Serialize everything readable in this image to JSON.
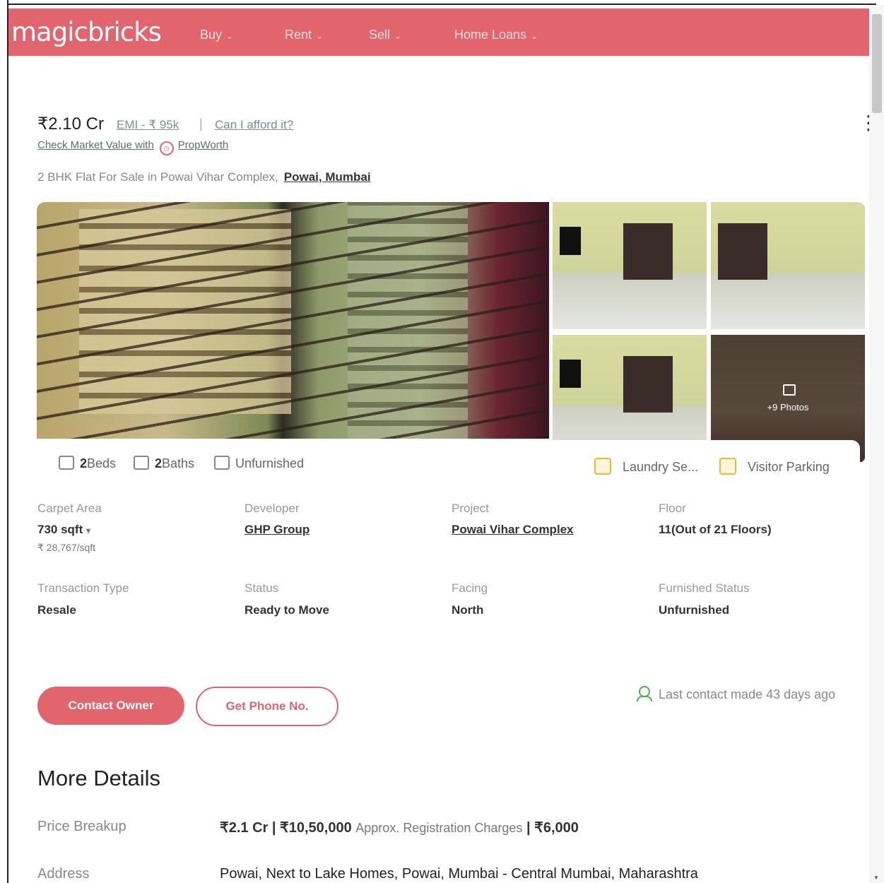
{
  "header": {
    "logo": "magicbricks",
    "nav": [
      {
        "label": "Buy"
      },
      {
        "label": "Rent"
      },
      {
        "label": "Sell"
      },
      {
        "label": "Home Loans"
      }
    ]
  },
  "listing": {
    "price": "₹2.10 Cr",
    "emi": "EMI - ₹ 95k",
    "afford": "Can I afford it?",
    "market_value": "Check Market Value with",
    "propworth": "PropWorth",
    "title": "2 BHK Flat For Sale in Powai Vihar Complex,",
    "location": "Powai, Mumbai"
  },
  "gallery": {
    "more_photos": "+9 Photos"
  },
  "features": {
    "beds_count": "2",
    "beds_label": "Beds",
    "baths_count": "2",
    "baths_label": "Baths",
    "furnishing": "Unfurnished",
    "amenity1": "Laundry Se...",
    "amenity2": "Visitor Parking"
  },
  "details": {
    "carpet_area": {
      "label": "Carpet Area",
      "value": "730 sqft",
      "sub": "₹ 28,767/sqft"
    },
    "developer": {
      "label": "Developer",
      "value": "GHP Group"
    },
    "project": {
      "label": "Project",
      "value": "Powai Vihar Complex"
    },
    "floor": {
      "label": "Floor",
      "value": "11(Out of 21 Floors)"
    },
    "transaction": {
      "label": "Transaction Type",
      "value": "Resale"
    },
    "status": {
      "label": "Status",
      "value": "Ready to Move"
    },
    "facing": {
      "label": "Facing",
      "value": "North"
    },
    "furnished": {
      "label": "Furnished Status",
      "value": "Unfurnished"
    }
  },
  "actions": {
    "contact_owner": "Contact Owner",
    "get_phone": "Get Phone No.",
    "last_contact": "Last contact made 43 days ago"
  },
  "more_details": {
    "title": "More Details",
    "price_breakup_label": "Price Breakup",
    "price_breakup_value1": "₹2.1 Cr | ₹10,50,000",
    "price_breakup_muted": "Approx. Registration Charges",
    "price_breakup_value2": "| ₹6,000",
    "address_label": "Address",
    "address_value": "Powai, Next to Lake Homes, Powai, Mumbai - Central Mumbai, Maharashtra"
  },
  "colors": {
    "brand": "#e2646c",
    "amenity": "#e8b93a",
    "online": "#4caf50"
  }
}
